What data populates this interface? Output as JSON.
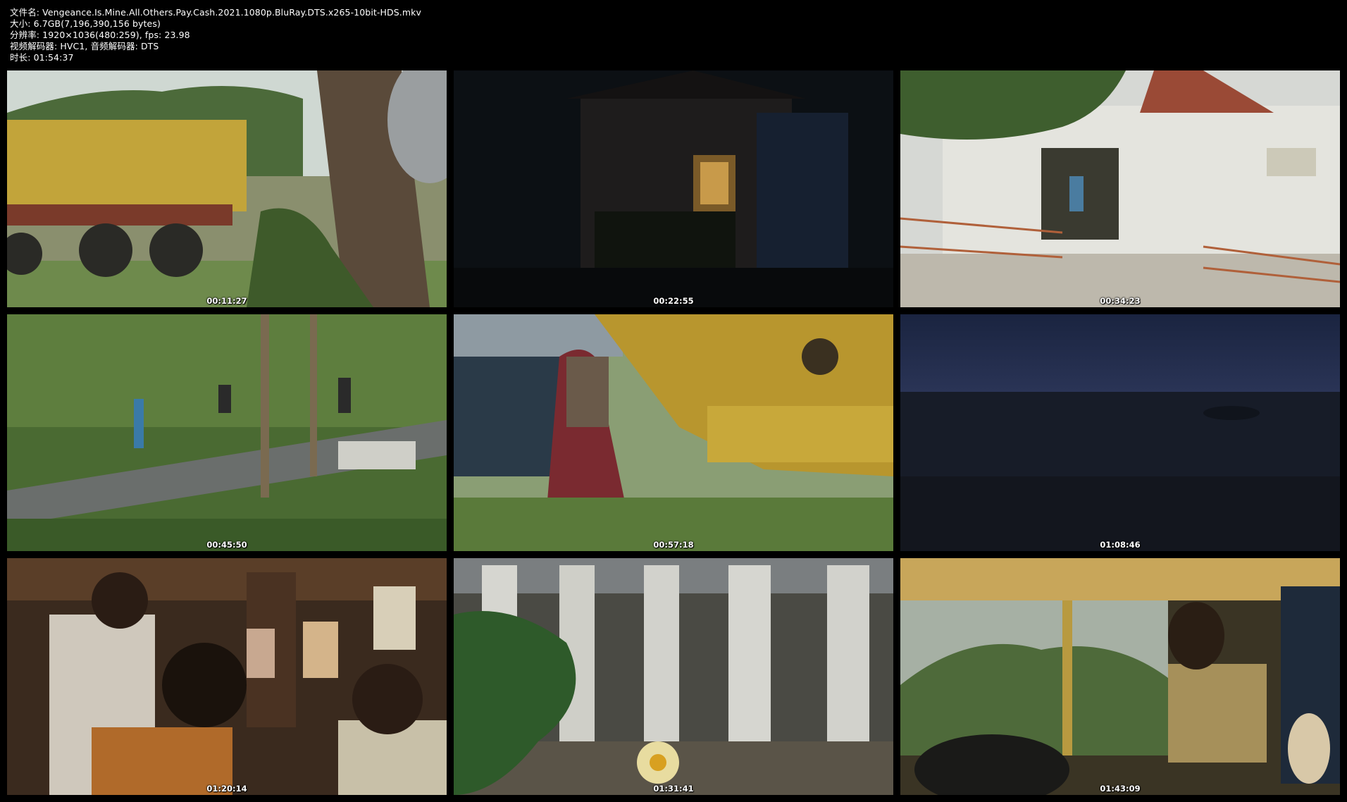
{
  "meta": {
    "filename_line": "文件名: Vengeance.Is.Mine.All.Others.Pay.Cash.2021.1080p.BluRay.DTS.x265-10bit-HDS.mkv",
    "size_line": "大小: 6.7GB(7,196,390,156 bytes)",
    "resolution_line": "分辨率: 1920×1036(480:259), fps: 23.98",
    "codec_line": "视频解码器: HVC1, 音频解码器: DTS",
    "duration_line": "时长: 01:54:37"
  },
  "thumbnails": [
    {
      "timestamp": "00:11:27"
    },
    {
      "timestamp": "00:22:55"
    },
    {
      "timestamp": "00:34:23"
    },
    {
      "timestamp": "00:45:50"
    },
    {
      "timestamp": "00:57:18"
    },
    {
      "timestamp": "01:08:46"
    },
    {
      "timestamp": "01:20:14"
    },
    {
      "timestamp": "01:31:41"
    },
    {
      "timestamp": "01:43:09"
    }
  ],
  "colors": {
    "background": "#000000",
    "text": "#ffffff"
  }
}
